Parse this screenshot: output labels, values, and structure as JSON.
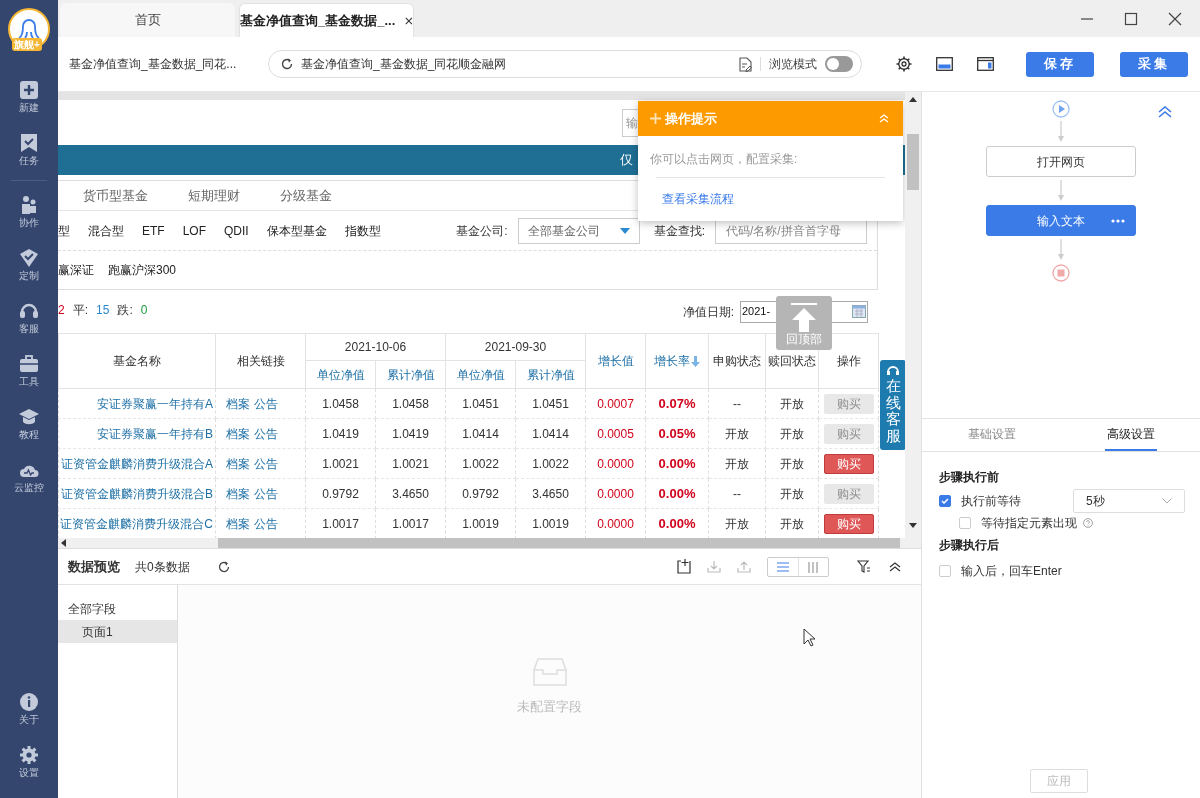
{
  "sidebar": {
    "badge": "旗舰+",
    "items": [
      {
        "label": "新建"
      },
      {
        "label": "任务"
      },
      {
        "label": "协作"
      },
      {
        "label": "定制"
      },
      {
        "label": "客服"
      },
      {
        "label": "工具"
      },
      {
        "label": "教程"
      },
      {
        "label": "云监控"
      }
    ],
    "bottom_items": [
      {
        "label": "关于"
      },
      {
        "label": "设置"
      }
    ]
  },
  "tabs": [
    {
      "label": "首页",
      "selected": false
    },
    {
      "label": "基金净值查询_基金数据_...",
      "selected": true
    }
  ],
  "address_bar": {
    "page_title": "基金净值查询_基金数据_同花...",
    "url": "基金净值查询_基金数据_同花顺金融网",
    "browse_mode": {
      "label": "浏览模式",
      "on": false
    }
  },
  "buttons": [
    "保存",
    "采集"
  ],
  "webpage": {
    "search_text": "输",
    "banner_text": "仅",
    "fund_tabs": [
      "货币型基金",
      "短期理财",
      "分级基金"
    ],
    "fund_types": [
      "型",
      "混合型",
      "ETF",
      "LOF",
      "QDII",
      "保本型基金",
      "指数型"
    ],
    "company_label": "基金公司:",
    "company_select": "全部基金公司",
    "search_label": "基金查找:",
    "search_placeholder": "代码/名称/拼音首字母",
    "themes": [
      "赢深证",
      "跑赢沪深300"
    ],
    "stats": [
      {
        "value": "2",
        "kind": "up"
      },
      {
        "label": "平:",
        "value": "15",
        "kind": "flat"
      },
      {
        "label": "跌:",
        "value": "0",
        "kind": "down"
      }
    ],
    "date_label": "净值日期:",
    "date_value": "2021-",
    "back_to_top": "回顶部",
    "online_service": "在线客服",
    "table": {
      "columns": [
        "基金名称",
        "相关链接",
        "增长值",
        "增长率",
        "申购状态",
        "赎回状态",
        "操作"
      ],
      "date_groups": [
        {
          "date": "2021-10-06",
          "sub": [
            "单位净值",
            "累计净值"
          ]
        },
        {
          "date": "2021-09-30",
          "sub": [
            "单位净值",
            "累计净值"
          ]
        }
      ],
      "rows": [
        {
          "name": "安证券聚赢一年持有A",
          "links": [
            "档案",
            "公告"
          ],
          "values": [
            "1.0458",
            "1.0458",
            "1.0451",
            "1.0451"
          ],
          "change": "0.0007",
          "rate": "0.07%",
          "subscribe": "--",
          "redeem": "开放",
          "action": "购买",
          "disabled": true
        },
        {
          "name": "安证券聚赢一年持有B",
          "links": [
            "档案",
            "公告"
          ],
          "values": [
            "1.0419",
            "1.0419",
            "1.0414",
            "1.0414"
          ],
          "change": "0.0005",
          "rate": "0.05%",
          "subscribe": "开放",
          "redeem": "开放",
          "action": "购买",
          "disabled": true
        },
        {
          "name": "证资管金麒麟消费升级混合A",
          "links": [
            "档案",
            "公告"
          ],
          "values": [
            "1.0021",
            "1.0021",
            "1.0022",
            "1.0022"
          ],
          "change": "0.0000",
          "rate": "0.00%",
          "subscribe": "开放",
          "redeem": "开放",
          "action": "购买",
          "disabled": false
        },
        {
          "name": "证资管金麒麟消费升级混合B",
          "links": [
            "档案",
            "公告"
          ],
          "values": [
            "0.9792",
            "3.4650",
            "0.9792",
            "3.4650"
          ],
          "change": "0.0000",
          "rate": "0.00%",
          "subscribe": "--",
          "redeem": "开放",
          "action": "购买",
          "disabled": true
        },
        {
          "name": "证资管金麒麟消费升级混合C",
          "links": [
            "档案",
            "公告"
          ],
          "values": [
            "1.0017",
            "1.0017",
            "1.0019",
            "1.0019"
          ],
          "change": "0.0000",
          "rate": "0.00%",
          "subscribe": "开放",
          "redeem": "开放",
          "action": "购买",
          "disabled": false
        }
      ]
    }
  },
  "tooltip": {
    "title": "操作提示",
    "text": "你可以点击网页，配置采集:",
    "link": "查看采集流程"
  },
  "data_preview": {
    "title": "数据预览",
    "count": "共0条数据",
    "views": [
      {
        "kind": "list",
        "selected": true
      },
      {
        "kind": "columns",
        "selected": false
      }
    ],
    "tree": [
      {
        "label": "全部字段",
        "selected": false,
        "children": [
          {
            "label": "页面1",
            "selected": true
          }
        ]
      }
    ],
    "empty_text": "未配置字段"
  },
  "flow": {
    "nodes": [
      {
        "label": "打开网页",
        "selected": false
      },
      {
        "label": "输入文本",
        "selected": true
      }
    ]
  },
  "settings": {
    "tabs": [
      {
        "label": "基础设置",
        "selected": false
      },
      {
        "label": "高级设置",
        "selected": true
      }
    ],
    "sections": [
      {
        "title": "步骤执行前",
        "options": [
          {
            "label": "执行前等待",
            "checked": true,
            "select": "5秒",
            "children": [
              {
                "label": "等待指定元素出现",
                "checked": false,
                "help": true
              }
            ]
          }
        ]
      },
      {
        "title": "步骤执行后",
        "options": [
          {
            "label": "输入后，回车Enter",
            "checked": false
          }
        ]
      }
    ],
    "apply_button": {
      "label": "应用",
      "disabled": true
    }
  }
}
